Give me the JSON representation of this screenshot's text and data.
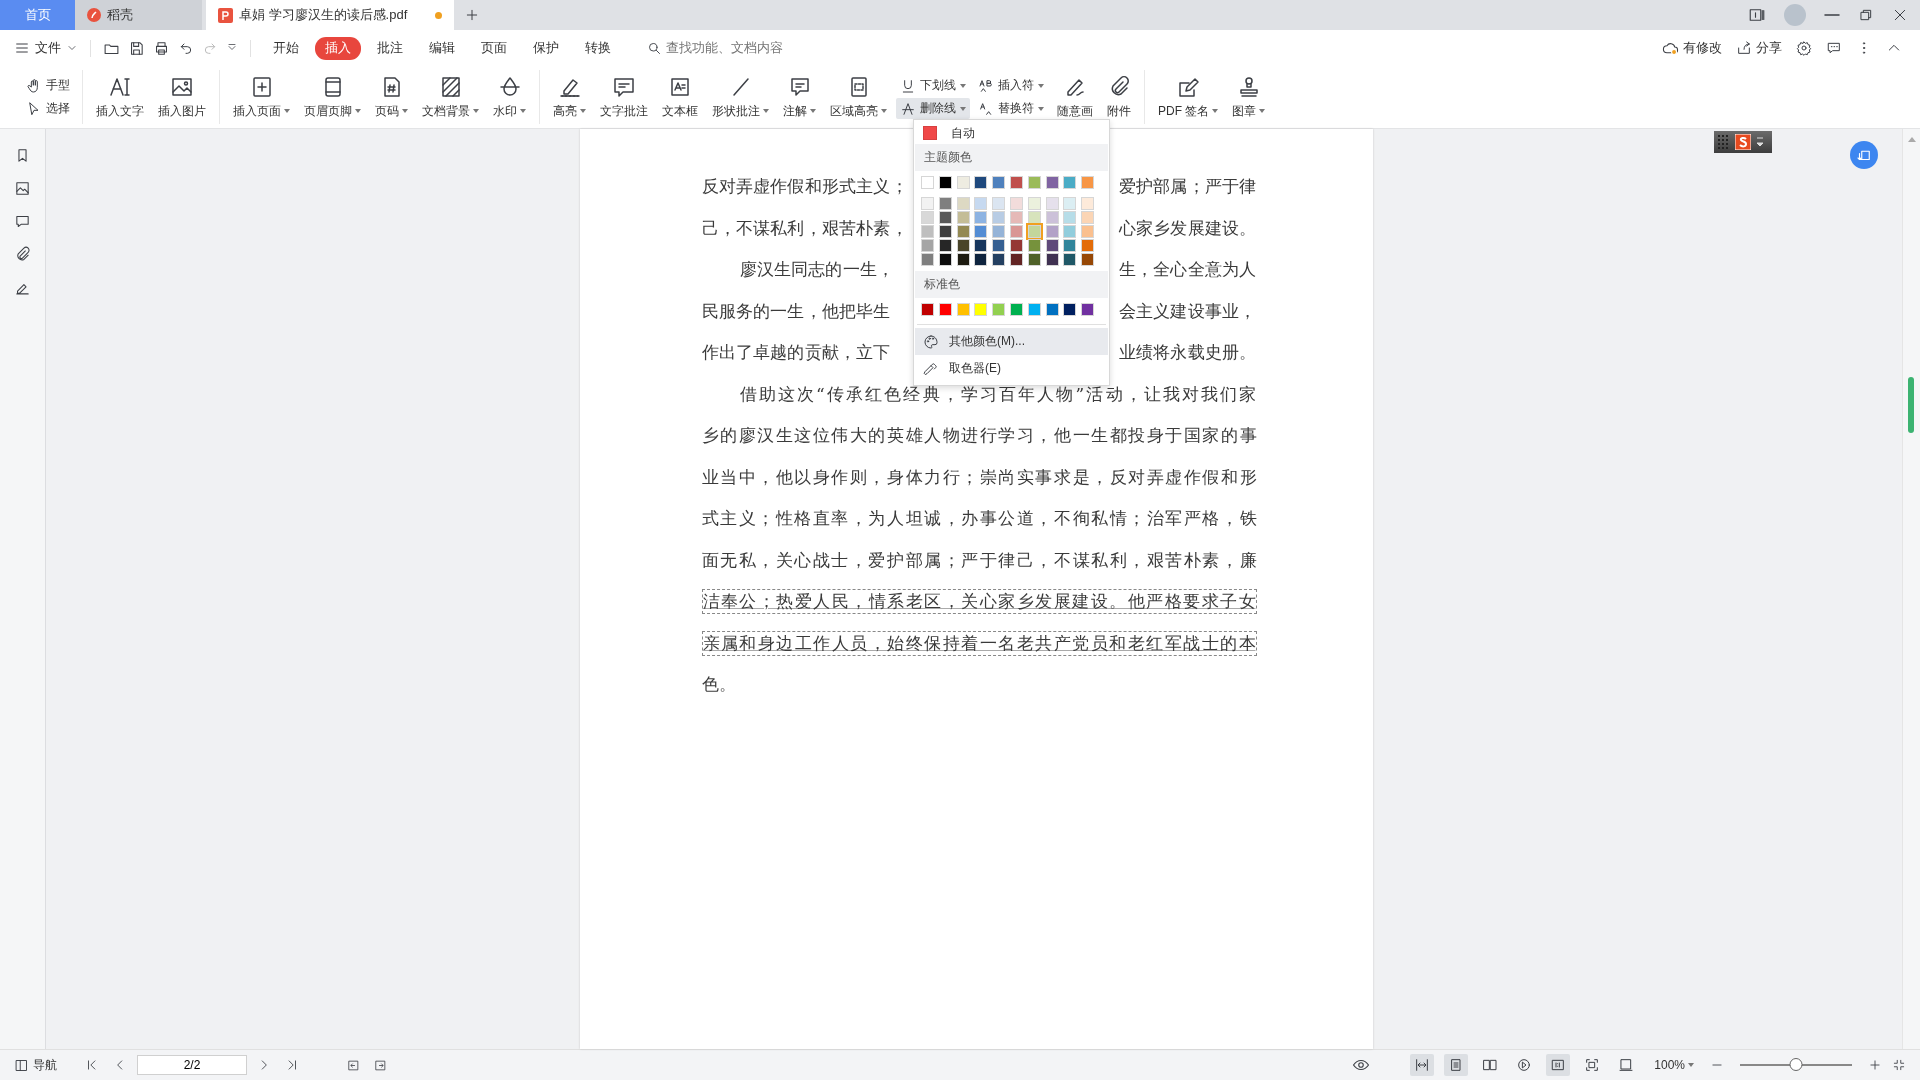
{
  "tabs": [
    {
      "kind": "home",
      "label": "首页",
      "selected": false
    },
    {
      "kind": "app",
      "label": "稻壳",
      "selected": false
    },
    {
      "kind": "doc",
      "label": "卓娟 学习廖汉生的读后感.pdf",
      "selected": true,
      "modified": true
    }
  ],
  "menubar": {
    "file_label": "文件",
    "tabs": [
      {
        "label": "开始",
        "selected": false
      },
      {
        "label": "插入",
        "selected": true
      },
      {
        "label": "批注",
        "selected": false
      },
      {
        "label": "编辑",
        "selected": false
      },
      {
        "label": "页面",
        "selected": false
      },
      {
        "label": "保护",
        "selected": false
      },
      {
        "label": "转换",
        "selected": false
      }
    ],
    "search": {
      "placeholder": "查找功能、文档内容"
    },
    "modified_label": "有修改",
    "share_label": "分享"
  },
  "ribbon": [
    [
      {
        "kind": "stack",
        "items": [
          {
            "label": "手型",
            "dropdown": false,
            "pressed": false
          },
          {
            "label": "选择",
            "dropdown": false,
            "pressed": false
          }
        ]
      }
    ],
    [
      {
        "kind": "large",
        "label": "插入文字",
        "dropdown": false
      },
      {
        "kind": "large",
        "label": "插入图片",
        "dropdown": false
      }
    ],
    [
      {
        "kind": "large",
        "label": "插入页面",
        "dropdown": true
      },
      {
        "kind": "large",
        "label": "页眉页脚",
        "dropdown": true
      },
      {
        "kind": "large",
        "label": "页码",
        "dropdown": true
      },
      {
        "kind": "large",
        "label": "文档背景",
        "dropdown": true
      },
      {
        "kind": "large",
        "label": "水印",
        "dropdown": true
      }
    ],
    [
      {
        "kind": "large",
        "label": "高亮",
        "dropdown": true
      },
      {
        "kind": "large",
        "label": "文字批注",
        "dropdown": false
      },
      {
        "kind": "large",
        "label": "文本框",
        "dropdown": false
      },
      {
        "kind": "large",
        "label": "形状批注",
        "dropdown": true
      },
      {
        "kind": "large",
        "label": "注解",
        "dropdown": true
      },
      {
        "kind": "large",
        "label": "区域高亮",
        "dropdown": true
      },
      {
        "kind": "stack",
        "items": [
          {
            "label": "下划线",
            "dropdown": true,
            "pressed": false
          },
          {
            "label": "删除线",
            "dropdown": true,
            "pressed": true
          }
        ]
      },
      {
        "kind": "stack",
        "items": [
          {
            "label": "插入符",
            "dropdown": true,
            "pressed": false
          },
          {
            "label": "替换符",
            "dropdown": true,
            "pressed": false
          }
        ]
      },
      {
        "kind": "large",
        "label": "随意画",
        "dropdown": false
      },
      {
        "kind": "large",
        "label": "附件",
        "dropdown": false
      }
    ],
    [
      {
        "kind": "large",
        "label": "PDF 签名",
        "dropdown": true
      },
      {
        "kind": "large",
        "label": "图章",
        "dropdown": true
      }
    ]
  ],
  "color_menu": {
    "auto": {
      "label": "自动",
      "color": "#f04848"
    },
    "theme_heading": "主题颜色",
    "theme": [
      {
        "color": "#ffffff",
        "selected": false
      },
      {
        "color": "#000000",
        "selected": false
      },
      {
        "color": "#eeece1",
        "selected": false
      },
      {
        "color": "#1f497d",
        "selected": false
      },
      {
        "color": "#4f81bd",
        "selected": false
      },
      {
        "color": "#c0504d",
        "selected": false
      },
      {
        "color": "#9bbb59",
        "selected": false
      },
      {
        "color": "#8064a2",
        "selected": false
      },
      {
        "color": "#4bacc6",
        "selected": false
      },
      {
        "color": "#f79646",
        "selected": false
      }
    ],
    "shades": [
      [
        {
          "color": "#f2f2f2",
          "selected": false
        },
        {
          "color": "#7f7f7f",
          "selected": false
        },
        {
          "color": "#ddd9c3",
          "selected": false
        },
        {
          "color": "#c6d9f0",
          "selected": false
        },
        {
          "color": "#dbe5f1",
          "selected": false
        },
        {
          "color": "#f2dcdb",
          "selected": false
        },
        {
          "color": "#ebf1dd",
          "selected": false
        },
        {
          "color": "#e5e0ec",
          "selected": false
        },
        {
          "color": "#dbeef3",
          "selected": false
        },
        {
          "color": "#fdeada",
          "selected": false
        }
      ],
      [
        {
          "color": "#d8d8d8",
          "selected": false
        },
        {
          "color": "#595959",
          "selected": false
        },
        {
          "color": "#c4bd97",
          "selected": false
        },
        {
          "color": "#8db3e2",
          "selected": false
        },
        {
          "color": "#b8cce4",
          "selected": false
        },
        {
          "color": "#e5b9b7",
          "selected": false
        },
        {
          "color": "#d7e3bc",
          "selected": false
        },
        {
          "color": "#ccc1d9",
          "selected": false
        },
        {
          "color": "#b7dde8",
          "selected": false
        },
        {
          "color": "#fbd5b5",
          "selected": false
        }
      ],
      [
        {
          "color": "#bfbfbf",
          "selected": false
        },
        {
          "color": "#3f3f3f",
          "selected": false
        },
        {
          "color": "#938953",
          "selected": false
        },
        {
          "color": "#548dd4",
          "selected": false
        },
        {
          "color": "#95b3d7",
          "selected": false
        },
        {
          "color": "#d99694",
          "selected": false
        },
        {
          "color": "#c3d69b",
          "selected": true
        },
        {
          "color": "#b2a2c7",
          "selected": false
        },
        {
          "color": "#92cddc",
          "selected": false
        },
        {
          "color": "#fac08f",
          "selected": false
        }
      ],
      [
        {
          "color": "#a5a5a5",
          "selected": false
        },
        {
          "color": "#262626",
          "selected": false
        },
        {
          "color": "#494429",
          "selected": false
        },
        {
          "color": "#17365d",
          "selected": false
        },
        {
          "color": "#366092",
          "selected": false
        },
        {
          "color": "#953734",
          "selected": false
        },
        {
          "color": "#76923c",
          "selected": false
        },
        {
          "color": "#5f497a",
          "selected": false
        },
        {
          "color": "#31859b",
          "selected": false
        },
        {
          "color": "#e36c09",
          "selected": false
        }
      ],
      [
        {
          "color": "#7f7f7f",
          "selected": false
        },
        {
          "color": "#0c0c0c",
          "selected": false
        },
        {
          "color": "#1d1b10",
          "selected": false
        },
        {
          "color": "#0f243e",
          "selected": false
        },
        {
          "color": "#244061",
          "selected": false
        },
        {
          "color": "#632423",
          "selected": false
        },
        {
          "color": "#4f6128",
          "selected": false
        },
        {
          "color": "#3f3151",
          "selected": false
        },
        {
          "color": "#205867",
          "selected": false
        },
        {
          "color": "#974806",
          "selected": false
        }
      ]
    ],
    "standard_heading": "标准色",
    "standard": [
      {
        "color": "#c00000",
        "selected": false
      },
      {
        "color": "#ff0000",
        "selected": false
      },
      {
        "color": "#ffc000",
        "selected": false
      },
      {
        "color": "#ffff00",
        "selected": false
      },
      {
        "color": "#92d050",
        "selected": false
      },
      {
        "color": "#00b050",
        "selected": false
      },
      {
        "color": "#00b0f0",
        "selected": false
      },
      {
        "color": "#0070c0",
        "selected": false
      },
      {
        "color": "#002060",
        "selected": false
      },
      {
        "color": "#7030a0",
        "selected": false
      }
    ],
    "items": [
      {
        "label": "其他颜色(M)...",
        "highlighted": true
      },
      {
        "label": "取色器(E)",
        "highlighted": false
      }
    ]
  },
  "document": {
    "lines": [
      {
        "kind": "split",
        "left": "反对弄虚作假和形式主义；",
        "right": "爱护部属；严于律",
        "indent": false,
        "marked": false
      },
      {
        "kind": "split",
        "left": "己，不谋私利，艰苦朴素，",
        "right": "心家乡发展建设。",
        "indent": false,
        "marked": false
      },
      {
        "kind": "split",
        "left": "廖汉生同志的一生，",
        "right": "生，全心全意为人",
        "indent": true,
        "marked": false
      },
      {
        "kind": "split",
        "left": "民服务的一生，他把毕生",
        "right": "会主义建设事业，",
        "indent": false,
        "marked": false
      },
      {
        "kind": "split",
        "left": "作出了卓越的贡献，立下",
        "right": "业绩将永载史册。",
        "indent": false,
        "marked": false
      },
      {
        "kind": "full",
        "text": "借助这次“传承红色经典，学习百年人物”活动，让我对我们家",
        "indent": true,
        "marked": false
      },
      {
        "kind": "full",
        "text": "乡的廖汉生这位伟大的英雄人物进行学习，他一生都投身于国家的事",
        "indent": false,
        "marked": false
      },
      {
        "kind": "full",
        "text": "业当中，他以身作则，身体力行；崇尚实事求是，反对弄虚作假和形",
        "indent": false,
        "marked": false
      },
      {
        "kind": "full",
        "text": "式主义；性格直率，为人坦诚，办事公道，不徇私情；治军严格，铁",
        "indent": false,
        "marked": false
      },
      {
        "kind": "full",
        "text": "面无私，关心战士，爱护部属；严于律己，不谋私利，艰苦朴素，廉",
        "indent": false,
        "marked": false
      },
      {
        "kind": "full",
        "text": "洁奉公；热爱人民，情系老区，关心家乡发展建设。他严格要求子女",
        "indent": false,
        "marked": true
      },
      {
        "kind": "full",
        "text": "亲属和身边工作人员，始终保持着一名老共产党员和老红军战士的本",
        "indent": false,
        "marked": true
      },
      {
        "kind": "last",
        "text": "色。",
        "indent": false,
        "marked": false
      }
    ]
  },
  "status_bar": {
    "nav_label": "导航",
    "page": "2/2",
    "views": [
      {
        "selected": true
      },
      {
        "selected": true
      },
      {
        "selected": false
      },
      {
        "selected": false
      },
      {
        "selected": true
      },
      {
        "selected": false
      },
      {
        "selected": false
      }
    ],
    "zoom": "100%",
    "zoom_slider": {
      "level": 0.5
    }
  }
}
